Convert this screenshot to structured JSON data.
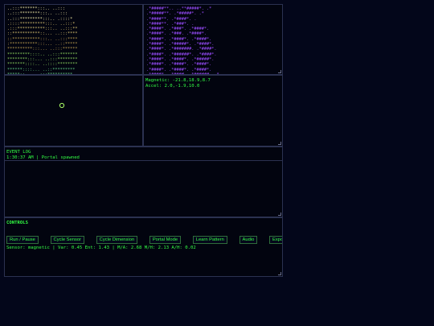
{
  "top_left_art": [
    "..:::*******:::.. ..:::",
    "..:::********:::.. ..:::",
    "..:::*********:::.. .::::*",
    ".::::**********:::.. ..:::*",
    ".:::***********:::.. ..:::**",
    "::***********::... ..:::****",
    "::***********:::.. ..:::****",
    ":***********:::... ..::*****",
    "**********:::... ..:::******",
    "*********::::.. ..:::*******",
    "********:::... ..:::********",
    "*******::::.. ..::::********",
    "******::::... ..::*********",
    "*****::... ..:::**********"
  ],
  "top_right_art": [
    ".*#####**.. ..**#####*. .*",
    ".*#####**. .*#####*. .*",
    ".*####**. .*####*. .",
    ".*####**. .*###*. .",
    ".*####*. .*###*. .*####*.",
    ".*####*. .*###. .*####*.",
    ".*####*. .*####*. .*####*.",
    ".*####*. .*#####*. .*####*.",
    ".*####*. .*#######. .*####*.",
    ".*####*. .*######*. .*####*.",
    ".*####*. .*####*. .*#####*.",
    ".*####*. .*####*. .*####*.",
    ".*####*. .*####*. .*####*.",
    ".*####*. .*####. .*######. .*"
  ],
  "sensor_readout": {
    "magnetic": "Magnetic: -21.8,18.9,8.7",
    "accel": "Accel: 2.0,-1.9,10.0"
  },
  "event_log": {
    "title": "EVENT LOG",
    "entries": [
      "1:30:37 AM | Portal spawned"
    ]
  },
  "controls": {
    "title": "CONTROLS",
    "buttons": [
      "Run / Pause",
      "Cycle Sensor",
      "Cycle Dimension",
      "Portal Mode",
      "Learn Pattern",
      "Audio",
      "Export CSV"
    ],
    "status": "Sensor: magnetic | Var: 0.45 Ent: 1.43 | M/A: 2.68 M/H: 2.13 A/H: 0.02"
  },
  "colors": {
    "background": "#03061a",
    "accent_green": "#33ff44",
    "ascii_purple": "#9b4dff",
    "border": "#2b3150"
  }
}
